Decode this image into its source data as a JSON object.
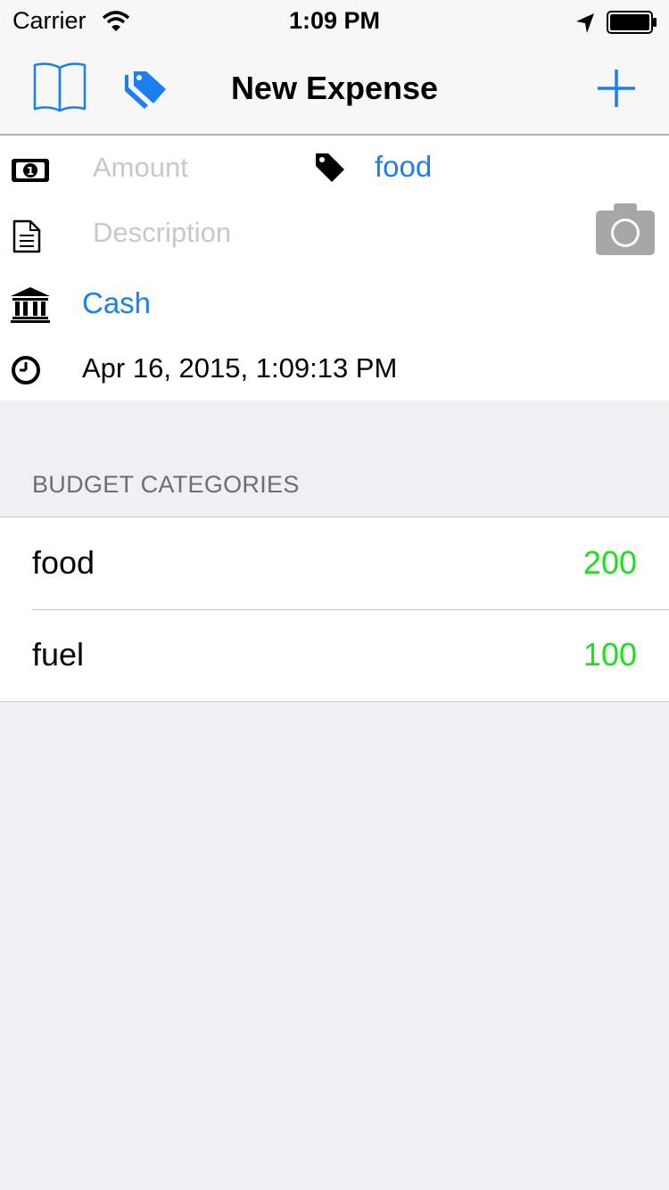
{
  "status_bar": {
    "carrier": "Carrier",
    "time": "1:09 PM",
    "icons": [
      "wifi-icon",
      "location-arrow-icon",
      "battery-icon"
    ]
  },
  "nav_bar": {
    "title": "New Expense",
    "left_buttons": [
      "book-icon",
      "tags-icon"
    ],
    "right_button": "plus-icon"
  },
  "form": {
    "amount_placeholder": "Amount",
    "tag_value": "food",
    "description_placeholder": "Description",
    "account_value": "Cash",
    "datetime_value": "Apr 16, 2015, 1:09:13 PM",
    "icons": [
      "money-icon",
      "tag-icon",
      "document-icon",
      "camera-icon",
      "bank-icon",
      "clock-icon"
    ]
  },
  "budget": {
    "header": "BUDGET CATEGORIES",
    "items": [
      {
        "name": "food",
        "amount": "200"
      },
      {
        "name": "fuel",
        "amount": "100"
      }
    ]
  },
  "colors": {
    "accent": "#1a7ff0",
    "positive": "#1fe01f",
    "placeholder": "#c7c7cd",
    "background": "#efeff4"
  }
}
